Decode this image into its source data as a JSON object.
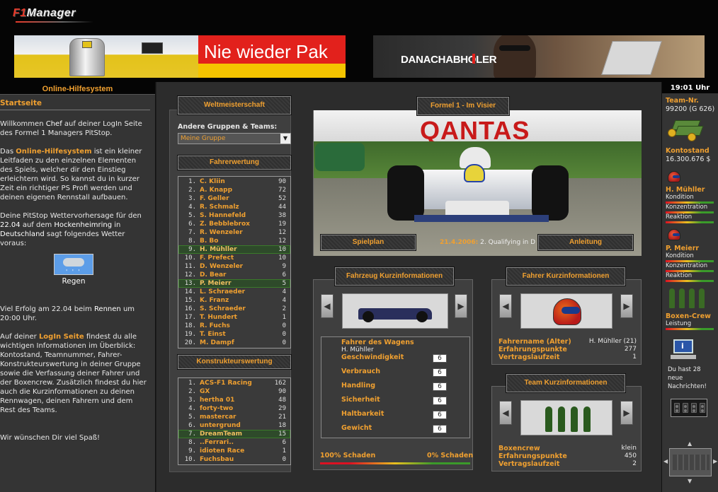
{
  "header": {
    "logo": {
      "f1": "F1",
      "rest": "Manager"
    },
    "banner_left_text": "Nie wieder Pak",
    "banner_right_text": "DANACHABHOLER"
  },
  "help": {
    "title": "Online-Hilfesystem",
    "start": "Startseite",
    "p1_a": "Willkommen ",
    "p1_name": "Chef",
    "p1_b": " auf deiner LogIn Seite des Formel 1 Managers PitStop.",
    "p2_a": "Das ",
    "p2_link": "Online-Hilfesystem",
    "p2_b": " ist ein kleiner Leitfaden zu den einzelnen Elementen des Spiels, welcher dir den Einstieg erleichtern wird. So kannst du in kurzer Zeit ein richtiger PS Profi werden und deinen eigenen Rennstall aufbauen.",
    "p3_a": "Deine PitStop Wettervorhersage für den ",
    "p3_date": "22.04",
    "p3_b": " auf dem ",
    "p3_track": "Hockenheimring",
    "p3_c": " in ",
    "p3_country": "Deutschland",
    "p3_d": " sagt folgendes Wetter voraus:",
    "weather_icon": "rain-cloud-icon",
    "weather_label": "Regen",
    "p4_a": "Viel Erfolg am 22.04 beim ",
    "p4_race": "Rennen",
    "p4_b": " um 20:00 Uhr.",
    "p5_a": "Auf deiner ",
    "p5_link": "LogIn Seite",
    "p5_b": " findest du alle wichtigen Informationen im Überblick: Kontostand, Teamnummer, Fahrer-Konstrukteurswertung in deiner Gruppe sowie die Verfassung deiner Fahrer und der Boxencrew. Zusätzlich findest du hier auch die Kurzinformationen zu deinen Rennwagen, deinen Fahrern und dem Rest des Teams.",
    "p6": "Wir wünschen Dir viel Spaß!"
  },
  "wm": {
    "title": "Weltmeisterschaft",
    "groups_label": "Andere Gruppen & Teams:",
    "group_selected": "Meine Gruppe",
    "drivers_title": "Fahrerwertung",
    "drivers": [
      {
        "pos": "1.",
        "name": "C. Kliin",
        "pts": "90",
        "hl": false
      },
      {
        "pos": "2.",
        "name": "A. Knapp",
        "pts": "72",
        "hl": false
      },
      {
        "pos": "3.",
        "name": "F. Geller",
        "pts": "52",
        "hl": false
      },
      {
        "pos": "4.",
        "name": "R. Schmalz",
        "pts": "44",
        "hl": false
      },
      {
        "pos": "5.",
        "name": "S. Hannefeld",
        "pts": "38",
        "hl": false
      },
      {
        "pos": "6.",
        "name": "Z. Bebblebrox",
        "pts": "19",
        "hl": false
      },
      {
        "pos": "7.",
        "name": "R. Wenzeler",
        "pts": "12",
        "hl": false
      },
      {
        "pos": "8.",
        "name": "B. Bo",
        "pts": "12",
        "hl": false
      },
      {
        "pos": "9.",
        "name": "H. Mühller",
        "pts": "10",
        "hl": true
      },
      {
        "pos": "10.",
        "name": "F. Prefect",
        "pts": "10",
        "hl": false
      },
      {
        "pos": "11.",
        "name": "D. Wenzeler",
        "pts": "9",
        "hl": false
      },
      {
        "pos": "12.",
        "name": "D. Bear",
        "pts": "6",
        "hl": false
      },
      {
        "pos": "13.",
        "name": "P. Meierr",
        "pts": "5",
        "hl": true
      },
      {
        "pos": "14.",
        "name": "L. Schraeder",
        "pts": "4",
        "hl": false
      },
      {
        "pos": "15.",
        "name": "K. Franz",
        "pts": "4",
        "hl": false
      },
      {
        "pos": "16.",
        "name": "S. Schraeder",
        "pts": "2",
        "hl": false
      },
      {
        "pos": "17.",
        "name": "T. Hundert",
        "pts": "1",
        "hl": false
      },
      {
        "pos": "18.",
        "name": "R. Fuchs",
        "pts": "0",
        "hl": false
      },
      {
        "pos": "19.",
        "name": "T. Einst",
        "pts": "0",
        "hl": false
      },
      {
        "pos": "20.",
        "name": "M. Dampf",
        "pts": "0",
        "hl": false
      }
    ],
    "constructors_title": "Konstrukteurswertung",
    "constructors": [
      {
        "pos": "1.",
        "name": "ACS-F1 Racing",
        "pts": "162",
        "hl": false
      },
      {
        "pos": "2.",
        "name": "GX",
        "pts": "90",
        "hl": false
      },
      {
        "pos": "3.",
        "name": "hertha 01",
        "pts": "48",
        "hl": false
      },
      {
        "pos": "4.",
        "name": "forty-two",
        "pts": "29",
        "hl": false
      },
      {
        "pos": "5.",
        "name": "mastercar",
        "pts": "21",
        "hl": false
      },
      {
        "pos": "6.",
        "name": "untergrund",
        "pts": "18",
        "hl": false
      },
      {
        "pos": "7.",
        "name": "DreamTeam",
        "pts": "15",
        "hl": true
      },
      {
        "pos": "8.",
        "name": "..Ferrari..",
        "pts": "6",
        "hl": false
      },
      {
        "pos": "9.",
        "name": "idioten Race",
        "pts": "1",
        "hl": false
      },
      {
        "pos": "10.",
        "name": "Fuchsbau",
        "pts": "0",
        "hl": false
      }
    ]
  },
  "visier": {
    "title": "Formel 1 - Im Visier",
    "ad_text": "QANTAS",
    "spielplan": "Spielplan",
    "date": "21.4.2006:",
    "event": "2. Qualifying in D",
    "anleitung": "Anleitung"
  },
  "fahrzeug": {
    "title": "Fahrzeug Kurzinformationen",
    "driver_label": "Fahrer des Wagens",
    "driver_value": "H. Mühller",
    "stats": [
      {
        "label": "Geschwindigkeit",
        "value": "6"
      },
      {
        "label": "Verbrauch",
        "value": "6"
      },
      {
        "label": "Handling",
        "value": "6"
      },
      {
        "label": "Sicherheit",
        "value": "6"
      },
      {
        "label": "Haltbarkeit",
        "value": "6"
      },
      {
        "label": "Gewicht",
        "value": "6"
      }
    ],
    "damage_left": "100% Schaden",
    "damage_right": "0% Schaden"
  },
  "fahrer": {
    "title": "Fahrer Kurzinformationen",
    "rows": [
      {
        "label": "Fahrername (Alter)",
        "value": "H. Mühller (21)"
      },
      {
        "label": "Erfahrungspunkte",
        "value": "277"
      },
      {
        "label": "Vertragslaufzeit",
        "value": "1"
      }
    ]
  },
  "team": {
    "title": "Team Kurzinformationen",
    "rows": [
      {
        "label": "Boxencrew",
        "value": "klein"
      },
      {
        "label": "Erfahrungspunkte",
        "value": "450"
      },
      {
        "label": "Vertragslaufzeit",
        "value": "2"
      }
    ]
  },
  "side": {
    "clock": "19:01 Uhr",
    "team_label": "Team-Nr.",
    "team_value": "99200 (G 626)",
    "konto_label": "Kontostand",
    "konto_value": "16.300.676 $",
    "driver1_name": "H. Mühller",
    "driver2_name": "P. Meierr",
    "kondition": "Kondition",
    "konzentration": "Konzentration",
    "reaktion": "Reaktion",
    "crew_label": "Boxen-Crew",
    "leistung": "Leistung",
    "mail_text": "Du hast 28 neue Nachrichten!"
  },
  "colors": {
    "accent": "#f0a030",
    "highlight_row": "#2e4a2a",
    "panel_bg": "#3f3f3f"
  }
}
